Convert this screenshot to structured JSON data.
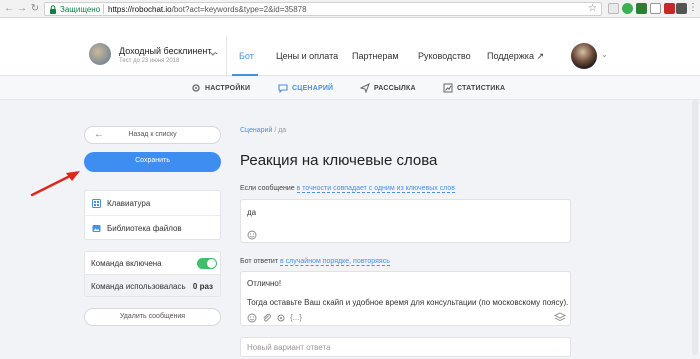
{
  "browser": {
    "secure_label": "Защищено",
    "url_host": "https://robochat.io",
    "url_path": "/bot?act=keywords&type=2&id=35878"
  },
  "header": {
    "bot_name": "Доходный бесклинент...",
    "bot_date": "Тест до 23 июня 2018",
    "nav": [
      "Бот",
      "Цены и оплата",
      "Партнерам",
      "Руководство",
      "Поддержка ↗"
    ]
  },
  "subnav": {
    "items": [
      "НАСТРОЙКИ",
      "СЦЕНАРИЙ",
      "РАССЫЛКА",
      "СТАТИСТИКА"
    ]
  },
  "sidebar": {
    "back_label": "Назад к списку",
    "save_label": "Сохранить",
    "menu": [
      "Клавиатура",
      "Библиотека файлов"
    ],
    "enabled_label": "Команда включена",
    "usage_label": "Команда использовалась",
    "usage_value": "0 раз",
    "delete_label": "Удалить сообщения"
  },
  "main": {
    "breadcrumb_link": "Сценарий",
    "breadcrumb_sep": "/",
    "breadcrumb_current": "да",
    "title": "Реакция на ключевые слова",
    "condition_prefix": "Если сообщение",
    "condition_link": "в точности совпадает с одним из ключевых слов",
    "keyword": "да",
    "answer_prefix": "Бот ответит",
    "answer_link": "в случайном порядке, повторяясь",
    "answer_line1": "Отлично!",
    "answer_line2": "Тогда оставьте Ваш скайп и удобное время для консультации (по московскому поясу).",
    "answer_tool_code": "{...}",
    "new_answer_placeholder": "Новый вариант ответа"
  },
  "colors": {
    "accent": "#4a90e2",
    "save_button": "#3d8ef0",
    "toggle_on": "#3fbf6b",
    "annotation": "#e0261b"
  }
}
